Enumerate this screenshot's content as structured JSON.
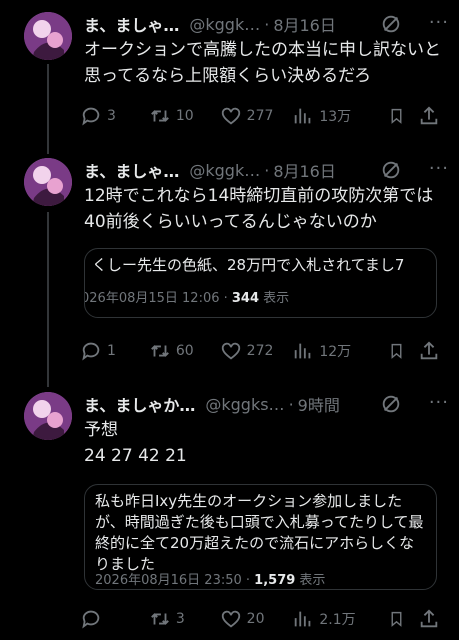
{
  "posts": [
    {
      "name": "ま、ましゃ…",
      "handle": "@kggk…",
      "dot": "·",
      "time": "8月16日",
      "text": "オークションで高騰したの本当に申し訳ないと思ってるなら上限額くらい決めるだろ",
      "replies": "3",
      "reposts": "10",
      "likes": "277",
      "views": "13万"
    },
    {
      "name": "ま、ましゃ…",
      "handle": "@kggk…",
      "dot": "·",
      "time": "8月16日",
      "text": "12時でこれなら14時締切直前の攻防次第では40前後くらいいってるんじゃないのか",
      "quote": {
        "text": "くしー先生の色紙、28万円で入札されてまし7",
        "meta_date": "026年08月15日 12:06 · ",
        "meta_views": "344",
        "meta_views_label": " 表示"
      },
      "replies": "1",
      "reposts": "60",
      "likes": "272",
      "views": "12万"
    },
    {
      "name": "ま、ましゃか…",
      "handle": "@kggks…",
      "dot": "·",
      "time": "9時間",
      "text": "予想\n24 27 42 21",
      "quote": {
        "text": "私も昨日Ixy先生のオークション参加しましたが、時間過ぎた後も口頭で入札募ってたりして最終的に全て20万超えたので流石にアホらしくなりました",
        "meta_date": "2026年08月16日 23:50 · ",
        "meta_views": "1,579",
        "meta_views_label": " 表示"
      },
      "replies": "",
      "reposts": "3",
      "likes": "20",
      "views": "2.1万"
    }
  ],
  "icons": {
    "reply": "reply-icon",
    "repost": "repost-icon",
    "like": "like-icon",
    "views": "views-icon",
    "bookmark": "bookmark-icon",
    "share": "share-icon",
    "grok": "grok-icon",
    "more": "more-icon"
  },
  "colors": {
    "background": "#000000",
    "text": "#e7e9ea",
    "muted": "#71767b",
    "border": "#2f3336"
  }
}
